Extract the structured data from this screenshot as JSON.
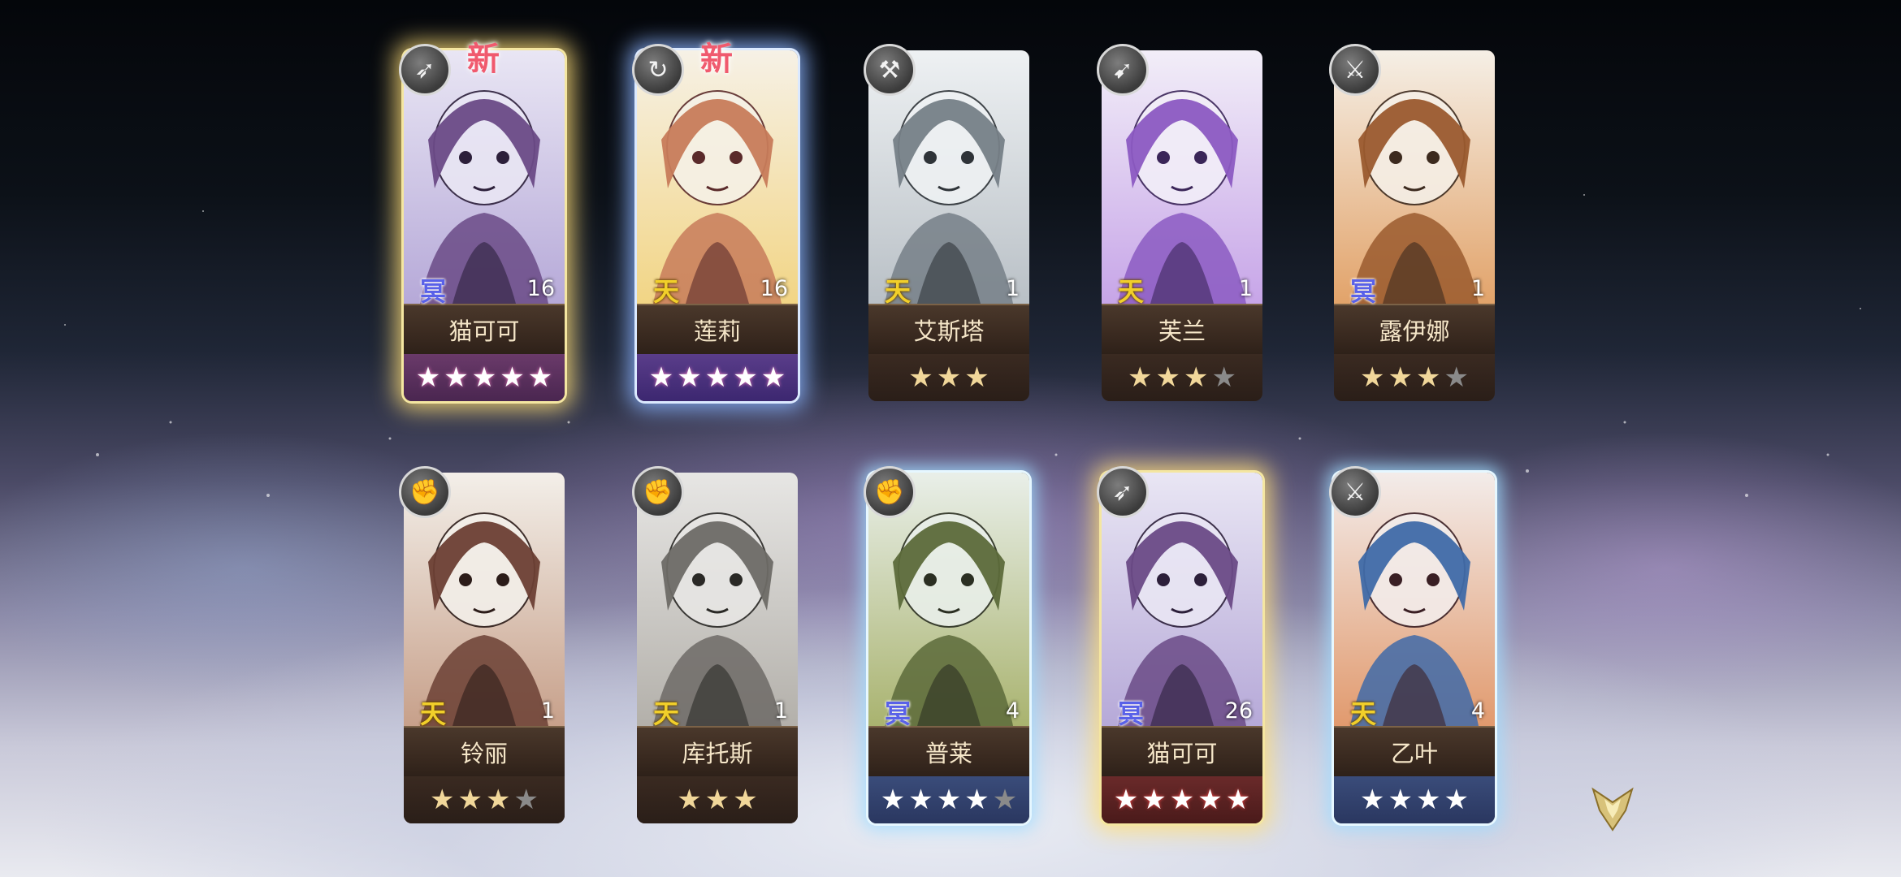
{
  "cards": [
    {
      "name": "猫可可",
      "element": "冥",
      "level": "16",
      "new": "新",
      "class_icon": "bow-icon",
      "glow": "gold",
      "star_style": "pink",
      "stars_total": 5,
      "stars_filled": 5
    },
    {
      "name": "莲莉",
      "element": "天",
      "level": "16",
      "new": "新",
      "class_icon": "circle-arrow-icon",
      "glow": "blue",
      "star_style": "purple",
      "stars_total": 5,
      "stars_filled": 5
    },
    {
      "name": "艾斯塔",
      "element": "天",
      "level": "1",
      "new": "",
      "class_icon": "axe-icon",
      "glow": "none",
      "star_style": "plain",
      "stars_total": 3,
      "stars_filled": 3
    },
    {
      "name": "芙兰",
      "element": "天",
      "level": "1",
      "new": "",
      "class_icon": "spear-icon",
      "glow": "none",
      "star_style": "plain",
      "stars_total": 4,
      "stars_filled": 3
    },
    {
      "name": "露伊娜",
      "element": "冥",
      "level": "1",
      "new": "",
      "class_icon": "sword-icon",
      "glow": "none",
      "star_style": "plain",
      "stars_total": 4,
      "stars_filled": 3
    },
    {
      "name": "铃丽",
      "element": "天",
      "level": "1",
      "new": "",
      "class_icon": "fist-icon",
      "glow": "none",
      "star_style": "plain",
      "stars_total": 4,
      "stars_filled": 3
    },
    {
      "name": "库托斯",
      "element": "天",
      "level": "1",
      "new": "",
      "class_icon": "fist-icon",
      "glow": "none",
      "star_style": "plain",
      "stars_total": 3,
      "stars_filled": 3
    },
    {
      "name": "普莱",
      "element": "冥",
      "level": "4",
      "new": "",
      "class_icon": "fist-icon",
      "glow": "cyan",
      "star_style": "blue",
      "stars_total": 5,
      "stars_filled": 4
    },
    {
      "name": "猫可可",
      "element": "冥",
      "level": "26",
      "new": "",
      "class_icon": "bow-icon",
      "glow": "gold",
      "star_style": "red",
      "stars_total": 5,
      "stars_filled": 5
    },
    {
      "name": "乙叶",
      "element": "天",
      "level": "4",
      "new": "",
      "class_icon": "sword-icon",
      "glow": "cyan",
      "star_style": "blue",
      "stars_total": 4,
      "stars_filled": 4
    }
  ],
  "menu_icon": "menu-emblem-icon",
  "colors": {
    "ming": "#5961e8",
    "tian": "#f1cf2a",
    "name_text": "#f5e6c8",
    "new_text": "#f05a6e"
  }
}
